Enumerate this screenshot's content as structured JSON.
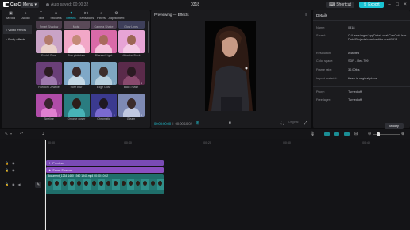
{
  "titlebar": {
    "app_name": "CapCut",
    "menu_label": "Menu",
    "autosave": "Auto saved: 00:00:32",
    "project_title": "0318",
    "shortcut_label": "Shortcut",
    "export_label": "Export"
  },
  "toolbar": {
    "items": [
      {
        "label": "Media",
        "icon": "media-icon"
      },
      {
        "label": "Audio",
        "icon": "audio-icon"
      },
      {
        "label": "Text",
        "icon": "text-icon"
      },
      {
        "label": "Stickers",
        "icon": "stickers-icon"
      },
      {
        "label": "Effects",
        "icon": "effects-icon",
        "active": true
      },
      {
        "label": "Transitions",
        "icon": "transitions-icon"
      },
      {
        "label": "Filters",
        "icon": "filters-icon"
      },
      {
        "label": "Adjustment",
        "icon": "adjustment-icon"
      }
    ]
  },
  "sidebar": {
    "items": [
      {
        "label": "Video effects"
      },
      {
        "label": "Body effects"
      }
    ]
  },
  "effects_top_labels": [
    "Smart Shadow",
    "Moist",
    "Camera Shake",
    "Glow Lines"
  ],
  "effects": [
    {
      "label": "Facial Glow",
      "bg": "#c9a3c6",
      "head": "#b27a6a",
      "body": "#e9d0c9"
    },
    {
      "label": "Play pinkstars",
      "bg": "#f2a7c7",
      "head": "#c48a78",
      "body": "#fbe1ef"
    },
    {
      "label": "Blessed Light",
      "bg": "#d96aa8",
      "head": "#a86a5c",
      "body": "#f5c2dc"
    },
    {
      "label": "Vibration Back",
      "bg": "#e7a4d6",
      "head": "#9c6655",
      "body": "#f4cbe6"
    },
    {
      "label": "Random Jewelie",
      "bg": "#6a3f78",
      "head": "#2c1c22",
      "body": "#a07bb0"
    },
    {
      "label": "Sore Blur",
      "bg": "#7fa8c7",
      "head": "#3a2a2a",
      "body": "#c5d9e6"
    },
    {
      "label": "Edge Glow",
      "bg": "#7fa6c0",
      "head": "#3d2e2b",
      "body": "#b8d0de"
    },
    {
      "label": "Black Flash",
      "bg": "#5a2a4a",
      "head": "#2b1a22",
      "body": "#8a4a6e"
    },
    {
      "label": "Sineline",
      "bg": "#b04ca8",
      "head": "#3a2430",
      "body": "#e07fd0"
    },
    {
      "label": "Chrome ooser",
      "bg": "#2a7c80",
      "head": "#2d1e1a",
      "body": "#47b3b7"
    },
    {
      "label": "Chromatic",
      "bg": "#3b3a8f",
      "head": "#1f1822",
      "body": "#7a6ad0"
    },
    {
      "label": "Gleam",
      "bg": "#7e8ab4",
      "head": "#3b2b2a",
      "body": "#c0c8e0"
    }
  ],
  "player": {
    "title": "Previewing — Effects",
    "current_time": "00:00:00:00",
    "total_time": "00:00:10:02"
  },
  "details": {
    "heading": "Details",
    "rows": [
      {
        "key": "Name:",
        "value": "0318"
      },
      {
        "key": "Saved:",
        "value": "C:/Users/mgm/AppData/Local/CapCut/User Data/Projects/com.lveditor.draft/0318"
      },
      {
        "key": "Resolution:",
        "value": "Adapted"
      },
      {
        "key": "Color space:",
        "value": "SDR - Rec.709"
      },
      {
        "key": "Frame rate:",
        "value": "30.00fps"
      },
      {
        "key": "Import material:",
        "value": "Keep in original place"
      },
      {
        "key": "Proxy:",
        "value": "Turned off"
      },
      {
        "key": "Free layer:",
        "value": "Turned off"
      }
    ],
    "modify_label": "Modify"
  },
  "timeline": {
    "ruler": [
      "00:00",
      "|00:10",
      "|00:20",
      "|00:30",
      "|00:40"
    ],
    "tracks": [
      {
        "label": "Preview",
        "color": "#7a4bb5"
      },
      {
        "label": "Smart Shadow",
        "color": "#8a4fc0"
      }
    ],
    "main_clip_label": "document_1234 1460 1940 1940.mp4  00:00:10:02"
  },
  "colors": {
    "accent": "#21c9da",
    "export": "#19c3d2"
  }
}
